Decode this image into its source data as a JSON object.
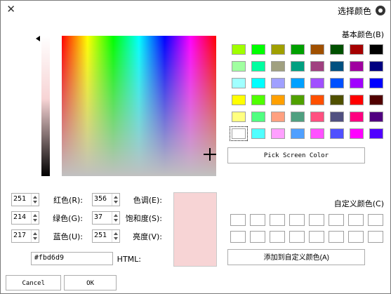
{
  "window": {
    "title": "选择颜色"
  },
  "basic_colors": {
    "label": "基本颜色(B)",
    "rows": [
      [
        "#000000",
        "#a50000",
        "#005000",
        "#a05000",
        "#00a000",
        "#a0a000",
        "#00ff00",
        "#a0ff00"
      ],
      [
        "#000080",
        "#a000a0",
        "#005080",
        "#a04080",
        "#00a080",
        "#a0a080",
        "#00ffa0",
        "#a0ffa0"
      ],
      [
        "#0000ff",
        "#a000ff",
        "#0050ff",
        "#a050ff",
        "#00a0ff",
        "#a0a0ff",
        "#00ffff",
        "#a0ffff"
      ],
      [
        "#500000",
        "#ff0000",
        "#505000",
        "#ff5000",
        "#50a000",
        "#ffa000",
        "#50ff00",
        "#ffff00"
      ],
      [
        "#500080",
        "#ff0080",
        "#505080",
        "#ff5080",
        "#50a080",
        "#ffa080",
        "#50ff80",
        "#ffff80"
      ],
      [
        "#5000ff",
        "#ff00ff",
        "#5050ff",
        "#ff50ff",
        "#50a0ff",
        "#ffa0ff",
        "#50ffff",
        "#ffffff"
      ]
    ],
    "selected_row": 5,
    "selected_col": 7
  },
  "buttons": {
    "pick_screen": "Pick Screen Color",
    "add_custom": "添加到自定义颜色(A)",
    "ok": "OK",
    "cancel": "Cancel"
  },
  "custom_colors": {
    "label": "自定义颜色(C)",
    "count": 16
  },
  "selected_color": "#f7d4d5",
  "fields": {
    "hue": {
      "label": "色调(E):",
      "value": "356"
    },
    "saturation": {
      "label": "饱和度(S):",
      "value": "37"
    },
    "value": {
      "label": "亮度(V):",
      "value": "251"
    },
    "red": {
      "label": "红色(R):",
      "value": "251"
    },
    "green": {
      "label": "绿色(G):",
      "value": "214"
    },
    "blue": {
      "label": "蓝色(U):",
      "value": "217"
    },
    "html": {
      "label": "HTML:",
      "value": "#fbd6d9"
    }
  }
}
